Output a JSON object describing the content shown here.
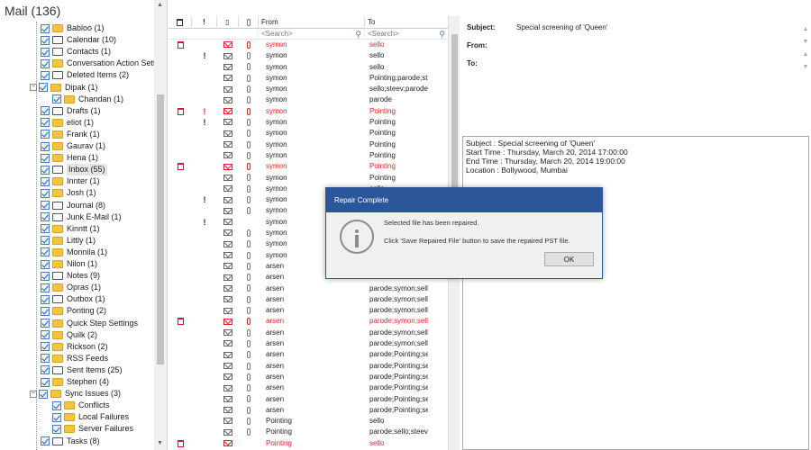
{
  "mail_header": {
    "title": "Mail (136)"
  },
  "folders": [
    {
      "label": "Babloo (1)"
    },
    {
      "label": "Calendar (10)"
    },
    {
      "label": "Contacts (1)"
    },
    {
      "label": "Conversation Action Setti"
    },
    {
      "label": "Deleted Items (2)"
    },
    {
      "label": "Dipak (1)"
    },
    {
      "label": "Chandan (1)"
    },
    {
      "label": "Drafts (1)"
    },
    {
      "label": "eliot (1)"
    },
    {
      "label": "Frank (1)"
    },
    {
      "label": "Gaurav (1)"
    },
    {
      "label": "Hena (1)"
    },
    {
      "label": "Inbox (55)"
    },
    {
      "label": "Innter (1)"
    },
    {
      "label": "Josh (1)"
    },
    {
      "label": "Journal (8)"
    },
    {
      "label": "Junk E-Mail (1)"
    },
    {
      "label": "Kinntt (1)"
    },
    {
      "label": "Littly (1)"
    },
    {
      "label": "Monnila (1)"
    },
    {
      "label": "Nilon (1)"
    },
    {
      "label": "Notes (9)"
    },
    {
      "label": "Opras (1)"
    },
    {
      "label": "Outbox (1)"
    },
    {
      "label": "Ponting (2)"
    },
    {
      "label": "Quick Step Settings"
    },
    {
      "label": "Quilk (2)"
    },
    {
      "label": "Rickson (2)"
    },
    {
      "label": "RSS Feeds"
    },
    {
      "label": "Sent Items (25)"
    },
    {
      "label": "Stephen (4)"
    },
    {
      "label": "Sync Issues (3)"
    },
    {
      "label": "Conflicts"
    },
    {
      "label": "Local Failures"
    },
    {
      "label": "Server Failures"
    },
    {
      "label": "Tasks (8)"
    }
  ],
  "message_list": {
    "headers": {
      "from": "From",
      "to": "To"
    },
    "search_placeholder_from": "<Search>",
    "search_placeholder_to": "<Search>",
    "rows": [
      {
        "from": "symon",
        "to": "sello",
        "red": true,
        "del": true,
        "imp": false,
        "att": true
      },
      {
        "from": "symon",
        "to": "sello",
        "red": false,
        "del": false,
        "imp": true,
        "att": true
      },
      {
        "from": "symon",
        "to": "sello",
        "red": false,
        "del": false,
        "imp": false,
        "att": true
      },
      {
        "from": "symon",
        "to": "Pointing;parode;steev",
        "red": false,
        "del": false,
        "imp": false,
        "att": true
      },
      {
        "from": "symon",
        "to": "sello;steev;parode;P",
        "red": false,
        "del": false,
        "imp": false,
        "att": true
      },
      {
        "from": "symon",
        "to": "parode",
        "red": false,
        "del": false,
        "imp": false,
        "att": true
      },
      {
        "from": "symon",
        "to": "Pointing",
        "red": true,
        "del": true,
        "imp": true,
        "att": true
      },
      {
        "from": "symon",
        "to": "Pointing",
        "red": false,
        "del": false,
        "imp": true,
        "att": true
      },
      {
        "from": "symon",
        "to": "Pointing",
        "red": false,
        "del": false,
        "imp": false,
        "att": true
      },
      {
        "from": "symon",
        "to": "Pointing",
        "red": false,
        "del": false,
        "imp": false,
        "att": true
      },
      {
        "from": "symon",
        "to": "Pointing",
        "red": false,
        "del": false,
        "imp": false,
        "att": true
      },
      {
        "from": "symon",
        "to": "Pointing",
        "red": true,
        "del": true,
        "imp": false,
        "att": true
      },
      {
        "from": "symon",
        "to": "Pointing",
        "red": false,
        "del": false,
        "imp": false,
        "att": true
      },
      {
        "from": "symon",
        "to": "sello",
        "red": false,
        "del": false,
        "imp": false,
        "att": true
      },
      {
        "from": "symon",
        "to": "",
        "red": false,
        "del": false,
        "imp": true,
        "att": true
      },
      {
        "from": "symon",
        "to": "",
        "red": false,
        "del": false,
        "imp": false,
        "att": true
      },
      {
        "from": "symon",
        "to": "",
        "red": false,
        "del": false,
        "imp": true,
        "att": false
      },
      {
        "from": "symon",
        "to": "",
        "red": false,
        "del": false,
        "imp": false,
        "att": true
      },
      {
        "from": "symon",
        "to": "",
        "red": false,
        "del": false,
        "imp": false,
        "att": true
      },
      {
        "from": "symon",
        "to": "",
        "red": false,
        "del": false,
        "imp": false,
        "att": true
      },
      {
        "from": "arsen",
        "to": "",
        "red": false,
        "del": false,
        "imp": false,
        "att": true
      },
      {
        "from": "arsen",
        "to": "",
        "red": false,
        "del": false,
        "imp": false,
        "att": true
      },
      {
        "from": "arsen",
        "to": "parode;symon;sello;s",
        "red": false,
        "del": false,
        "imp": false,
        "att": true
      },
      {
        "from": "arsen",
        "to": "parode;symon;sello;s",
        "red": false,
        "del": false,
        "imp": false,
        "att": true
      },
      {
        "from": "arsen",
        "to": "parode;symon;sello;s",
        "red": false,
        "del": false,
        "imp": false,
        "att": true
      },
      {
        "from": "arsen",
        "to": "parode;symon;sello;s",
        "red": true,
        "del": true,
        "imp": false,
        "att": true
      },
      {
        "from": "arsen",
        "to": "parode;symon;sello;s",
        "red": false,
        "del": false,
        "imp": false,
        "att": true
      },
      {
        "from": "arsen",
        "to": "parode;symon;sello;s",
        "red": false,
        "del": false,
        "imp": false,
        "att": true
      },
      {
        "from": "arsen",
        "to": "parode;Pointing;sello",
        "red": false,
        "del": false,
        "imp": false,
        "att": true
      },
      {
        "from": "arsen",
        "to": "parode;Pointing;sello",
        "red": false,
        "del": false,
        "imp": false,
        "att": true
      },
      {
        "from": "arsen",
        "to": "parode;Pointing;sello",
        "red": false,
        "del": false,
        "imp": false,
        "att": true
      },
      {
        "from": "arsen",
        "to": "parode;Pointing;sello",
        "red": false,
        "del": false,
        "imp": false,
        "att": true
      },
      {
        "from": "arsen",
        "to": "parode;Pointing;sello",
        "red": false,
        "del": false,
        "imp": false,
        "att": true
      },
      {
        "from": "arsen",
        "to": "parode;Pointing;sello",
        "red": false,
        "del": false,
        "imp": false,
        "att": true
      },
      {
        "from": "Pointing",
        "to": "sello",
        "red": false,
        "del": false,
        "imp": false,
        "att": true
      },
      {
        "from": "Pointing",
        "to": "parode;sello;steev",
        "red": false,
        "del": false,
        "imp": false,
        "att": true
      },
      {
        "from": "Pointing",
        "to": "sello",
        "red": true,
        "del": true,
        "imp": false,
        "att": false
      }
    ]
  },
  "reading_pane": {
    "subject_label": "Subject:",
    "subject_value": "Special screening of 'Queen'",
    "from_label": "From:",
    "to_label": "To:",
    "body_lines": [
      "Subject : Special screening of 'Queen'",
      "Start Time : Thursday, March 20, 2014 17:00:00",
      "End Time : Thursday, March 20, 2014 19:00:00",
      "Location : Bollywood, Mumbai"
    ]
  },
  "dialog": {
    "title": "Repair Complete",
    "line1": "Selected file has been repaired.",
    "line2": "Click 'Save Repaired File' button to save the repaired PST file.",
    "ok_label": "OK"
  },
  "colors": {
    "accent": "#2b579a",
    "unread_red": "#e02424",
    "folder_yellow": "#f5c342"
  }
}
